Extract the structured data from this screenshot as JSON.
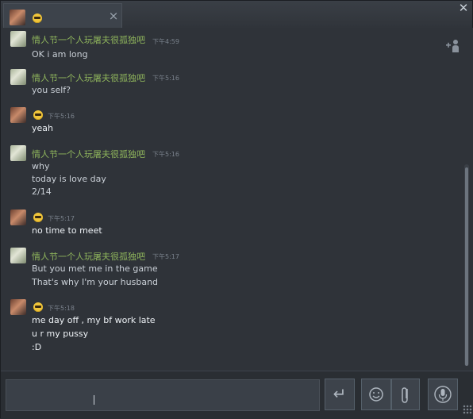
{
  "tab": {
    "title_icon": "sunglasses-emoji-icon",
    "close_label": "×"
  },
  "window": {
    "close_label": "✕"
  },
  "colors": {
    "friend_name": "#8fb55c",
    "background": "#2f3339",
    "text": "#c9cfd6"
  },
  "messages": [
    {
      "sender": "情人节一个人玩屠夫很孤独吧",
      "time": "下午4:59",
      "lines": [
        "OK i am long"
      ]
    },
    {
      "sender": "情人节一个人玩屠夫很孤独吧",
      "time": "下午5:16",
      "lines": [
        "you self?"
      ]
    },
    {
      "sender": "",
      "time": "下午5:16",
      "lines": [
        "yeah"
      ]
    },
    {
      "sender": "情人节一个人玩屠夫很孤独吧",
      "time": "下午5:16",
      "lines": [
        "why",
        "today is love day",
        "2/14"
      ]
    },
    {
      "sender": "",
      "time": "下午5:17",
      "lines": [
        "no time to meet"
      ]
    },
    {
      "sender": "情人节一个人玩屠夫很孤独吧",
      "time": "下午5:17",
      "lines": [
        "But you met me in the game",
        "That's why I'm your husband"
      ]
    },
    {
      "sender": "",
      "time": "下午5:18",
      "lines": [
        "me day off , my bf work late",
        "u r my pussy",
        ":D"
      ]
    }
  ],
  "composer": {
    "send_icon": "return-arrow-icon",
    "send_label": "↵",
    "emoticon_icon": "smiley-icon",
    "attach_icon": "paperclip-icon",
    "voice_icon": "microphone-icon"
  }
}
